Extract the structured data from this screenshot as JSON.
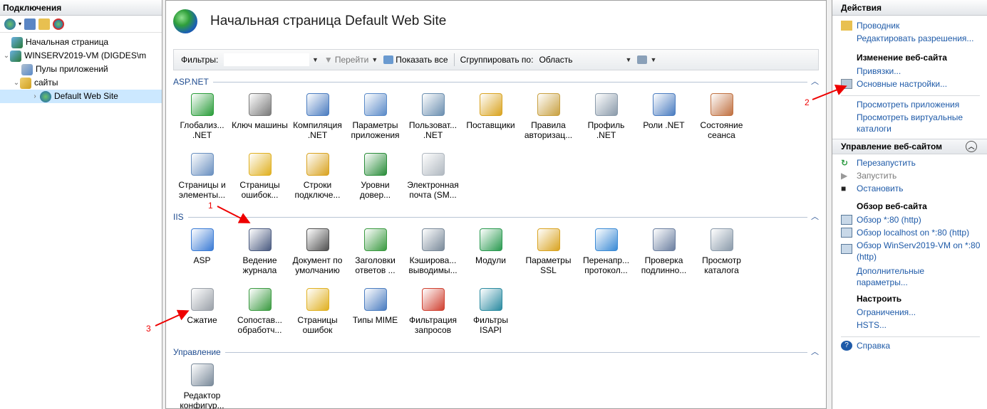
{
  "connections": {
    "title": "Подключения",
    "tree": [
      {
        "label": "Начальная страница",
        "indent": 0
      },
      {
        "label": "WINSERV2019-VM (DIGDES\\m",
        "indent": 0
      },
      {
        "label": "Пулы приложений",
        "indent": 1
      },
      {
        "label": "сайты",
        "indent": 1
      },
      {
        "label": "Default Web Site",
        "indent": 2
      }
    ]
  },
  "center": {
    "title": "Начальная страница Default Web Site",
    "filter_label": "Фильтры:",
    "go_label": "Перейти",
    "show_all_label": "Показать все",
    "group_by_label": "Сгруппировать по:",
    "group_by_value": "Область",
    "groups": [
      {
        "title": "ASP.NET",
        "items": [
          {
            "label": "Глобализ... .NET",
            "icon": "globe-icon",
            "color": "#2a9d3a"
          },
          {
            "label": "Ключ машины",
            "icon": "machine-key-icon",
            "color": "#7a7a7a"
          },
          {
            "label": "Компиляция .NET",
            "icon": "compilation-icon",
            "color": "#4a7cc0"
          },
          {
            "label": "Параметры приложения",
            "icon": "app-settings-icon",
            "color": "#5a8ac8"
          },
          {
            "label": "Пользоват... .NET",
            "icon": "users-icon",
            "color": "#6b8fb0"
          },
          {
            "label": "Поставщики",
            "icon": "providers-icon",
            "color": "#d9a320"
          },
          {
            "label": "Правила авторизац...",
            "icon": "authorization-icon",
            "color": "#c8a040"
          },
          {
            "label": "Профиль .NET",
            "icon": "profile-icon",
            "color": "#8a9aaa"
          },
          {
            "label": "Роли .NET",
            "icon": "roles-icon",
            "color": "#4a7cc0"
          },
          {
            "label": "Состояние сеанса",
            "icon": "session-icon",
            "color": "#c07040"
          },
          {
            "label": "Страницы и элементы...",
            "icon": "pages-controls-icon",
            "color": "#6a90c0"
          },
          {
            "label": "Страницы ошибок...",
            "icon": "error-pages-icon",
            "color": "#e0b020"
          },
          {
            "label": "Строки подключе...",
            "icon": "connection-strings-icon",
            "color": "#d9a320"
          },
          {
            "label": "Уровни довер...",
            "icon": "trust-levels-icon",
            "color": "#2a8d3a"
          },
          {
            "label": "Электронная почта (SM...",
            "icon": "email-icon",
            "color": "#b0b8c0"
          }
        ]
      },
      {
        "title": "IIS",
        "items": [
          {
            "label": "ASP",
            "icon": "asp-icon",
            "color": "#3a7bd5"
          },
          {
            "label": "Ведение журнала",
            "icon": "logging-icon",
            "color": "#4a5a80"
          },
          {
            "label": "Документ по умолчанию",
            "icon": "default-document-icon",
            "color": "#505050"
          },
          {
            "label": "Заголовки ответов ...",
            "icon": "response-headers-icon",
            "color": "#3a9a40"
          },
          {
            "label": "Кэширова... выводимы...",
            "icon": "output-caching-icon",
            "color": "#7a8a9a"
          },
          {
            "label": "Модули",
            "icon": "modules-icon",
            "color": "#2a9a50"
          },
          {
            "label": "Параметры SSL",
            "icon": "ssl-icon",
            "color": "#d9a320"
          },
          {
            "label": "Перенапр... протокол...",
            "icon": "redirect-icon",
            "color": "#3a8ad5"
          },
          {
            "label": "Проверка подлинно...",
            "icon": "authentication-icon",
            "color": "#6b7fa0"
          },
          {
            "label": "Просмотр каталога",
            "icon": "directory-browsing-icon",
            "color": "#8a9aaa"
          },
          {
            "label": "Сжатие",
            "icon": "compression-icon",
            "color": "#9aa0a8"
          },
          {
            "label": "Сопостав... обработч...",
            "icon": "handler-mappings-icon",
            "color": "#3a9a40"
          },
          {
            "label": "Страницы ошибок",
            "icon": "error-pages-iis-icon",
            "color": "#e0b020"
          },
          {
            "label": "Типы MIME",
            "icon": "mime-types-icon",
            "color": "#4a7cc0"
          },
          {
            "label": "Фильтрация запросов",
            "icon": "request-filtering-icon",
            "color": "#d04030"
          },
          {
            "label": "Фильтры ISAPI",
            "icon": "isapi-filters-icon",
            "color": "#2a8aa0"
          }
        ]
      },
      {
        "title": "Управление",
        "items": [
          {
            "label": "Редактор конфигур...",
            "icon": "config-editor-icon",
            "color": "#7a8a9a"
          }
        ]
      }
    ]
  },
  "actions": {
    "title": "Действия",
    "explore": "Проводник",
    "edit_permissions": "Редактировать разрешения...",
    "edit_site_head": "Изменение веб-сайта",
    "bindings": "Привязки...",
    "basic_settings": "Основные настройки...",
    "view_apps": "Просмотреть приложения",
    "view_vdirs": "Просмотреть виртуальные каталоги",
    "manage_head": "Управление веб-сайтом",
    "restart": "Перезапустить",
    "start": "Запустить",
    "stop": "Остановить",
    "browse_head": "Обзор веб-сайта",
    "browse_80": "Обзор *:80 (http)",
    "browse_localhost": "Обзор localhost on *:80 (http)",
    "browse_vm": "Обзор WinServ2019-VM on *:80 (http)",
    "advanced": "Дополнительные параметры...",
    "configure_head": "Настроить",
    "limits": "Ограничения...",
    "hsts": "HSTS...",
    "help": "Справка"
  },
  "annotations": {
    "a1": "1",
    "a2": "2",
    "a3": "3"
  }
}
